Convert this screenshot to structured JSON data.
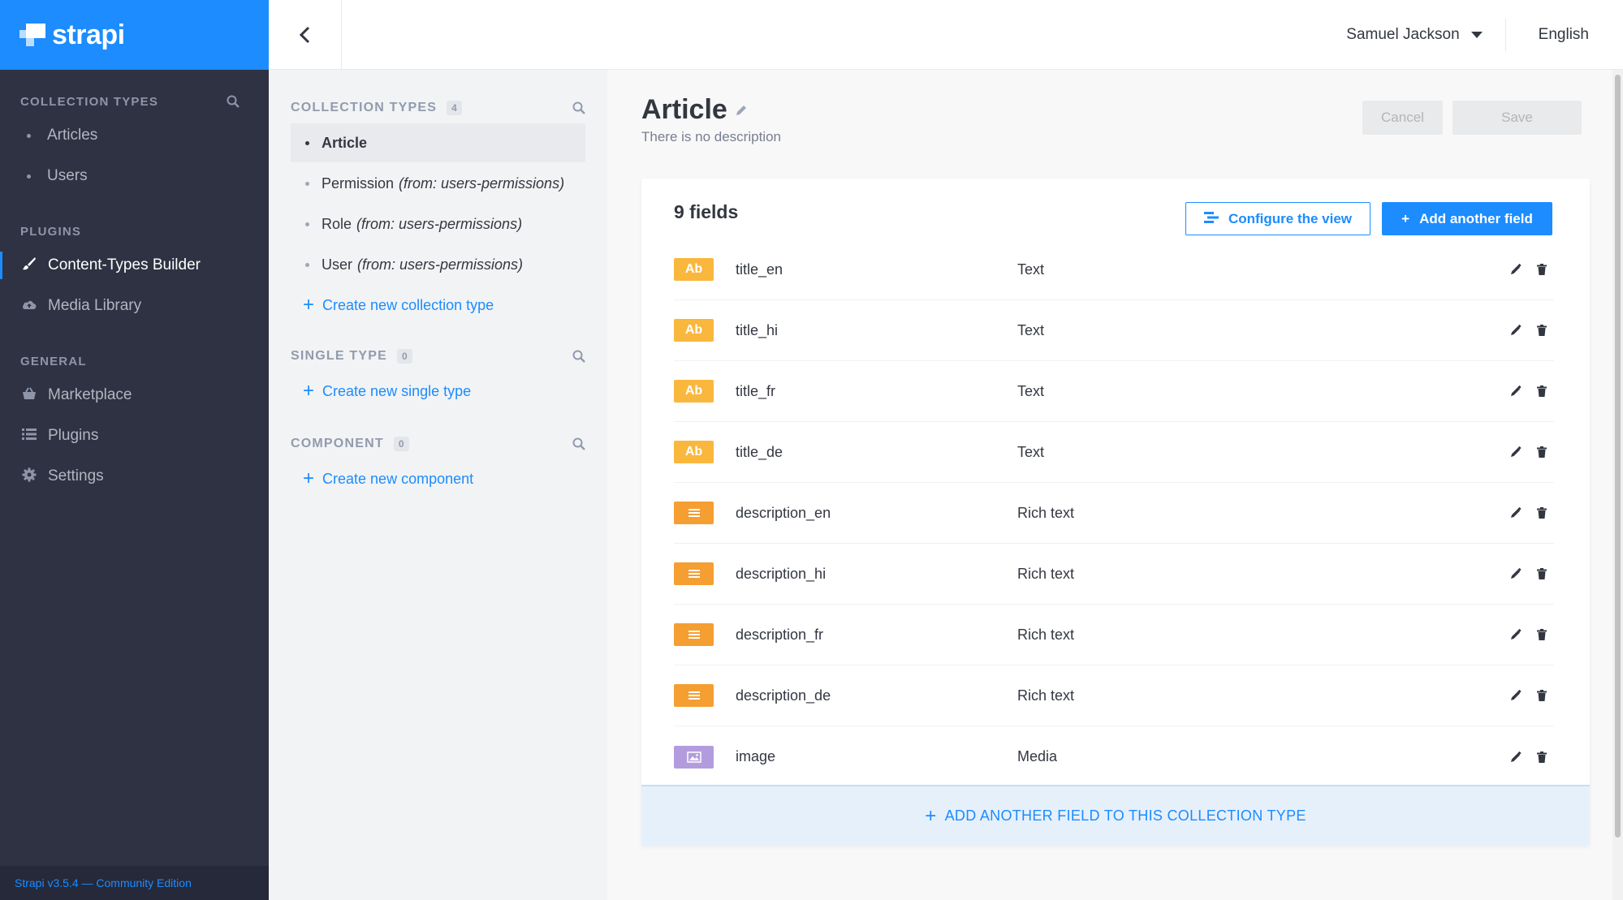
{
  "brand": {
    "name": "strapi"
  },
  "leftnav": {
    "sections": [
      {
        "title": "COLLECTION TYPES",
        "items": [
          {
            "label": "Articles"
          },
          {
            "label": "Users"
          }
        ]
      },
      {
        "title": "PLUGINS",
        "items": [
          {
            "label": "Content-Types Builder",
            "icon": "paintbrush-icon"
          },
          {
            "label": "Media Library",
            "icon": "cloud-icon"
          }
        ]
      },
      {
        "title": "GENERAL",
        "items": [
          {
            "label": "Marketplace",
            "icon": "basket-icon"
          },
          {
            "label": "Plugins",
            "icon": "list-icon"
          },
          {
            "label": "Settings",
            "icon": "gear-icon"
          }
        ]
      }
    ],
    "footer": "Strapi v3.5.4 — Community Edition"
  },
  "topbar": {
    "user": "Samuel Jackson",
    "language": "English"
  },
  "midcol": {
    "collection_header": "COLLECTION TYPES",
    "collection_count": "4",
    "collections": [
      {
        "label": "Article",
        "suffix": ""
      },
      {
        "label": "Permission",
        "suffix": "(from: users-permissions)"
      },
      {
        "label": "Role",
        "suffix": "(from: users-permissions)"
      },
      {
        "label": "User",
        "suffix": "(from: users-permissions)"
      }
    ],
    "create_collection": "Create new collection type",
    "single_header": "SINGLE TYPE",
    "single_count": "0",
    "create_single": "Create new single type",
    "component_header": "COMPONENT",
    "component_count": "0",
    "create_component": "Create new component"
  },
  "main": {
    "title": "Article",
    "description": "There is no description",
    "cancel": "Cancel",
    "save": "Save",
    "fields_count": "9 fields",
    "configure": "Configure the view",
    "add_field": "Add another field",
    "footer_add": "ADD ANOTHER FIELD TO THIS COLLECTION TYPE",
    "fields": [
      {
        "name": "title_en",
        "type": "Text",
        "badge": "Ab"
      },
      {
        "name": "title_hi",
        "type": "Text",
        "badge": "Ab"
      },
      {
        "name": "title_fr",
        "type": "Text",
        "badge": "Ab"
      },
      {
        "name": "title_de",
        "type": "Text",
        "badge": "Ab"
      },
      {
        "name": "description_en",
        "type": "Rich text",
        "badge": ""
      },
      {
        "name": "description_hi",
        "type": "Rich text",
        "badge": ""
      },
      {
        "name": "description_fr",
        "type": "Rich text",
        "badge": ""
      },
      {
        "name": "description_de",
        "type": "Rich text",
        "badge": ""
      },
      {
        "name": "image",
        "type": "Media",
        "badge": ""
      }
    ]
  },
  "colors": {
    "primary": "#1c8cff",
    "sidebar": "#2e3242",
    "text_badge": "#fab73d",
    "rich_badge": "#f59e32",
    "media_badge": "#b39cde"
  }
}
